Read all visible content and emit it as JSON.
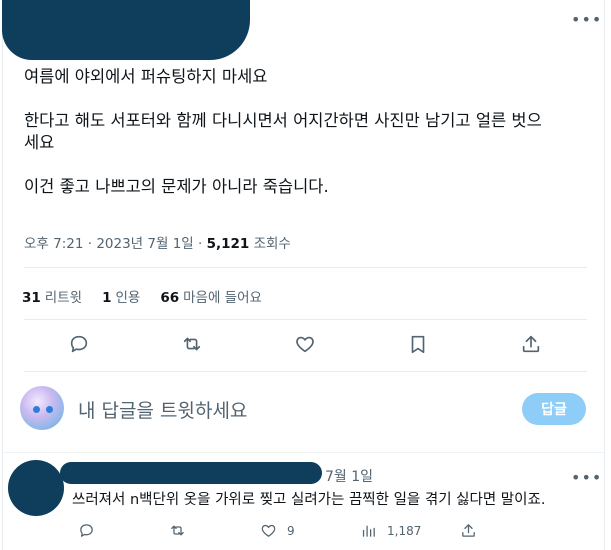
{
  "tweet": {
    "lines": [
      "여름에 야외에서 퍼슈팅하지 마세요",
      "한다고 해도 서포터와 함께 다니시면서 어지간하면 사진만 남기고 얼른 벗으",
      "세요",
      "이건 좋고 나쁘고의 문제가 아니라 죽습니다."
    ],
    "time": "오후 7:21 · 2023년 7월 1일 · ",
    "views_count": "5,121",
    "views_label": " 조회수"
  },
  "stats": {
    "retweets_count": "31",
    "retweets_label": "리트윗",
    "quotes_count": "1",
    "quotes_label": "인용",
    "likes_count": "66",
    "likes_label": "마음에 들어요"
  },
  "reply_box": {
    "placeholder": "내 답글을 트윗하세요",
    "button": "답글"
  },
  "comment": {
    "date": "7월 1일",
    "text": "쓰러져서 n백단위 옷을 가위로 찢고 실려가는 끔찍한 일을 겪기 싫다면 말이죠.",
    "likes": "9",
    "views": "1,187"
  },
  "colors": {
    "redaction": "#0f3d5c",
    "accent_disabled": "#8ecdf8",
    "muted": "#536471"
  },
  "icons": [
    "more-icon",
    "reply-icon",
    "retweet-icon",
    "like-icon",
    "bookmark-icon",
    "share-icon",
    "views-icon"
  ]
}
